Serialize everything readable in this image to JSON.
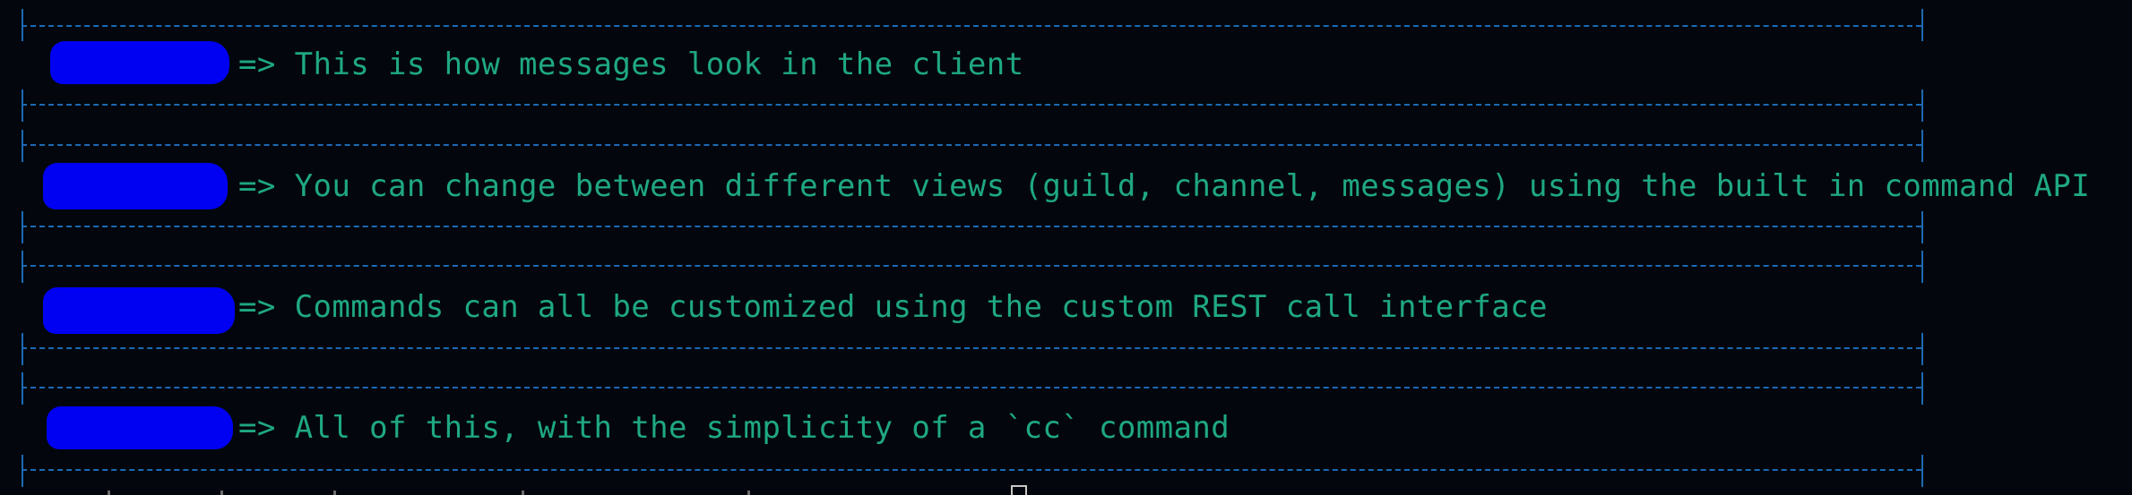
{
  "terminal": {
    "messages": [
      {
        "arrow": "=>",
        "text": "This is how messages look in the client"
      },
      {
        "arrow": "=>",
        "text": "You can change between different views (guild, channel, messages) using the built in command API"
      },
      {
        "arrow": "=>",
        "text": "Commands can all be customized using the custom REST call interface"
      },
      {
        "arrow": "=>",
        "text": "All of this, with the simplicity of a `cc` command"
      }
    ]
  },
  "colors": {
    "background": "#03070d",
    "text": "#1fa883",
    "border": "#1c69b4",
    "redaction": "#0000f2"
  }
}
